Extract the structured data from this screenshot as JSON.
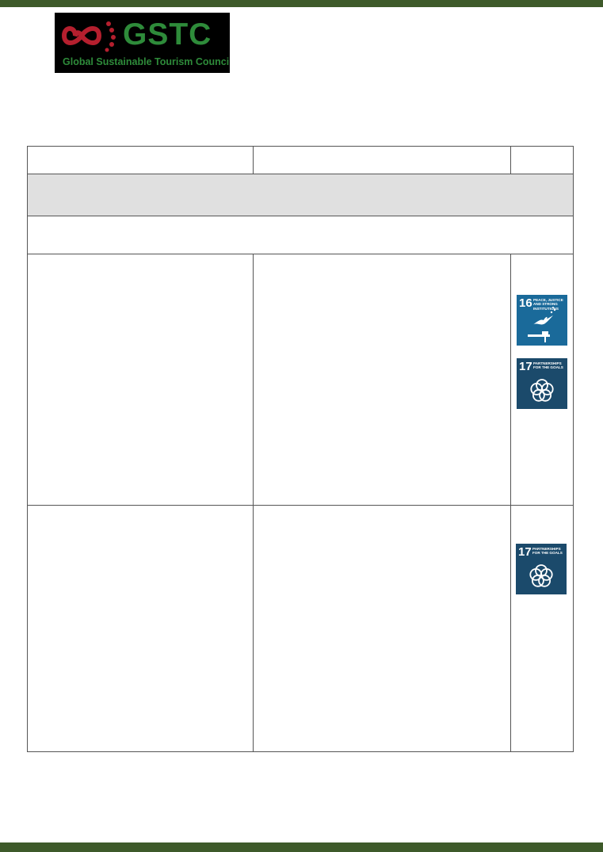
{
  "logo": {
    "wordmark": "GSTC",
    "subline": "Global Sustainable Tourism Council",
    "colors": {
      "background": "#000000",
      "accent_red": "#b51f2e",
      "accent_green": "#2e8b3a"
    }
  },
  "theme": {
    "bar_color": "#3e5a2a",
    "section_fill": "#e0e0e0",
    "border": "#555555"
  },
  "table": {
    "header": [
      "",
      "",
      ""
    ],
    "section_title": "",
    "subsection_title": "",
    "rows": [
      {
        "col1": "",
        "col2": "",
        "sdgs": [
          {
            "number": "16",
            "label": "Peace, Justice and Strong Institutions",
            "color": "#1a6a9a",
            "icon": "dove-gavel-icon"
          },
          {
            "number": "17",
            "label": "Partnerships for the Goals",
            "color": "#1b4a6b",
            "icon": "flower-rings-icon"
          }
        ]
      },
      {
        "col1": "",
        "col2": "",
        "sdgs": [
          {
            "number": "17",
            "label": "Partnerships for the Goals",
            "color": "#1b4a6b",
            "icon": "flower-rings-icon"
          }
        ]
      }
    ]
  }
}
